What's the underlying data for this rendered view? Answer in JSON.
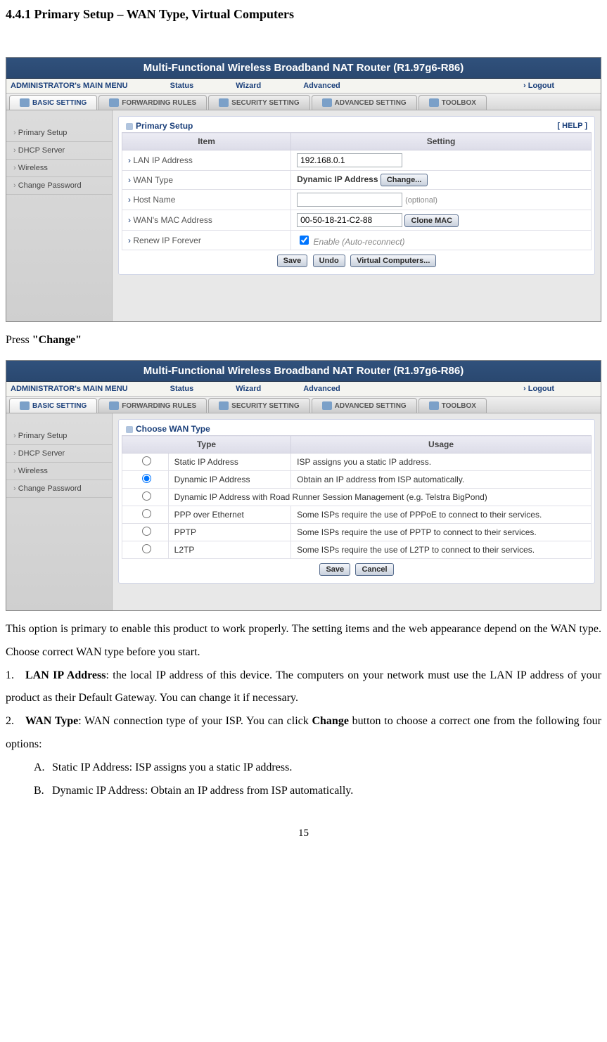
{
  "section_heading": "4.4.1 Primary Setup – WAN Type, Virtual Computers",
  "router": {
    "header_title": "Multi-Functional Wireless Broadband NAT Router (R1.97g6-R86)",
    "menu": {
      "main": "ADMINISTRATOR's MAIN MENU",
      "status": "Status",
      "wizard": "Wizard",
      "advanced": "Advanced",
      "logout": "Logout"
    },
    "tabs": {
      "basic": "BASIC SETTING",
      "forwarding": "FORWARDING RULES",
      "security": "SECURITY SETTING",
      "advanced": "ADVANCED SETTING",
      "toolbox": "TOOLBOX"
    },
    "sidebar": [
      "Primary Setup",
      "DHCP Server",
      "Wireless",
      "Change Password"
    ]
  },
  "primary_panel": {
    "title": "Primary Setup",
    "help": "[ HELP ]",
    "th_item": "Item",
    "th_setting": "Setting",
    "rows": {
      "lan_ip_label": "LAN IP Address",
      "lan_ip_value": "192.168.0.1",
      "wan_type_label": "WAN Type",
      "wan_type_value": "Dynamic IP Address",
      "change_btn": "Change...",
      "host_name_label": "Host Name",
      "host_name_value": "",
      "host_name_note": "(optional)",
      "wan_mac_label": "WAN's MAC Address",
      "wan_mac_value": "00-50-18-21-C2-88",
      "clone_mac_btn": "Clone MAC",
      "renew_ip_label": "Renew IP Forever",
      "renew_ip_note": "Enable (Auto-reconnect)"
    },
    "btn_save": "Save",
    "btn_undo": "Undo",
    "btn_virtual": "Virtual Computers..."
  },
  "press_change": "Press \"Change\"",
  "wan_panel": {
    "title": "Choose WAN Type",
    "th_type": "Type",
    "th_usage": "Usage",
    "rows": [
      {
        "type": "Static IP Address",
        "usage": "ISP assigns you a static IP address.",
        "checked": false
      },
      {
        "type": "Dynamic IP Address",
        "usage": "Obtain an IP address from ISP automatically.",
        "checked": true
      },
      {
        "type": "Dynamic IP Address with Road Runner Session Management (e.g. Telstra BigPond)",
        "usage": "",
        "checked": false,
        "span": true
      },
      {
        "type": "PPP over Ethernet",
        "usage": "Some ISPs require the use of PPPoE to connect to their services.",
        "checked": false
      },
      {
        "type": "PPTP",
        "usage": "Some ISPs require the use of PPTP to connect to their services.",
        "checked": false
      },
      {
        "type": "L2TP",
        "usage": "Some ISPs require the use of L2TP to connect to their services.",
        "checked": false
      }
    ],
    "btn_save": "Save",
    "btn_cancel": "Cancel"
  },
  "body_text": "This option is primary to enable this product to work properly. The setting items and the web appearance depend on the WAN type. Choose correct WAN type before you start.",
  "list": {
    "item1_bold": "LAN IP Address",
    "item1_rest": ": the local IP address of this device. The computers on your network must use the LAN IP address of your product as their Default Gateway. You can change it if necessary.",
    "item2_bold": "WAN Type",
    "item2_mid": ": WAN connection type of your ISP. You can click ",
    "item2_bold2": "Change",
    "item2_rest": " button to choose a correct one from the following four options:",
    "subA": "Static IP Address: ISP assigns you a static IP address.",
    "subB": "Dynamic IP Address: Obtain an IP address from ISP automatically."
  },
  "page_number": "15"
}
